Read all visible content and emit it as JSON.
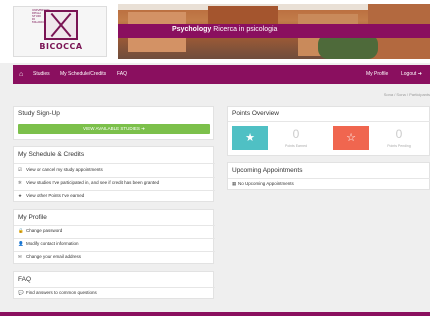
{
  "logo": {
    "name": "BICOCCA",
    "tiny_text": "UNIVERSITA DEGLI STUDI DI MILANO"
  },
  "banner": {
    "brand": "Psychology",
    "subtitle": "Ricerca in psicologia"
  },
  "nav": {
    "home_icon": "home-icon",
    "studies": "Studies",
    "my_schedule": "My Schedule/Credits",
    "faq": "FAQ",
    "my_profile": "My Profile",
    "logout": "Logout",
    "logout_icon": "exit-icon"
  },
  "breadcrumb": "Sona / Sona / Participants",
  "study_signup": {
    "title": "Study Sign-Up",
    "button": "VIEW AVAILABLE STUDIES"
  },
  "schedule": {
    "title": "My Schedule & Credits",
    "items": [
      "View or cancel my study appointments",
      "View studies I've participated in, and see if credit has been granted",
      "View other Points I've earned"
    ]
  },
  "profile": {
    "title": "My Profile",
    "items": [
      "Change password",
      "Modify contact information",
      "Change your email address"
    ]
  },
  "faq": {
    "title": "FAQ",
    "items": [
      "Find answers to common questions"
    ]
  },
  "points": {
    "title": "Points Overview",
    "earned": {
      "value": "0",
      "caption": "Points Earned"
    },
    "pending": {
      "value": "0",
      "caption": "Points Pending"
    }
  },
  "appointments": {
    "title": "Upcoming Appointments",
    "empty": "No Upcoming Appointments"
  },
  "colors": {
    "brand": "#8a0f5f",
    "green": "#7cc04b",
    "teal": "#4fc0c4",
    "coral": "#f0664f"
  }
}
